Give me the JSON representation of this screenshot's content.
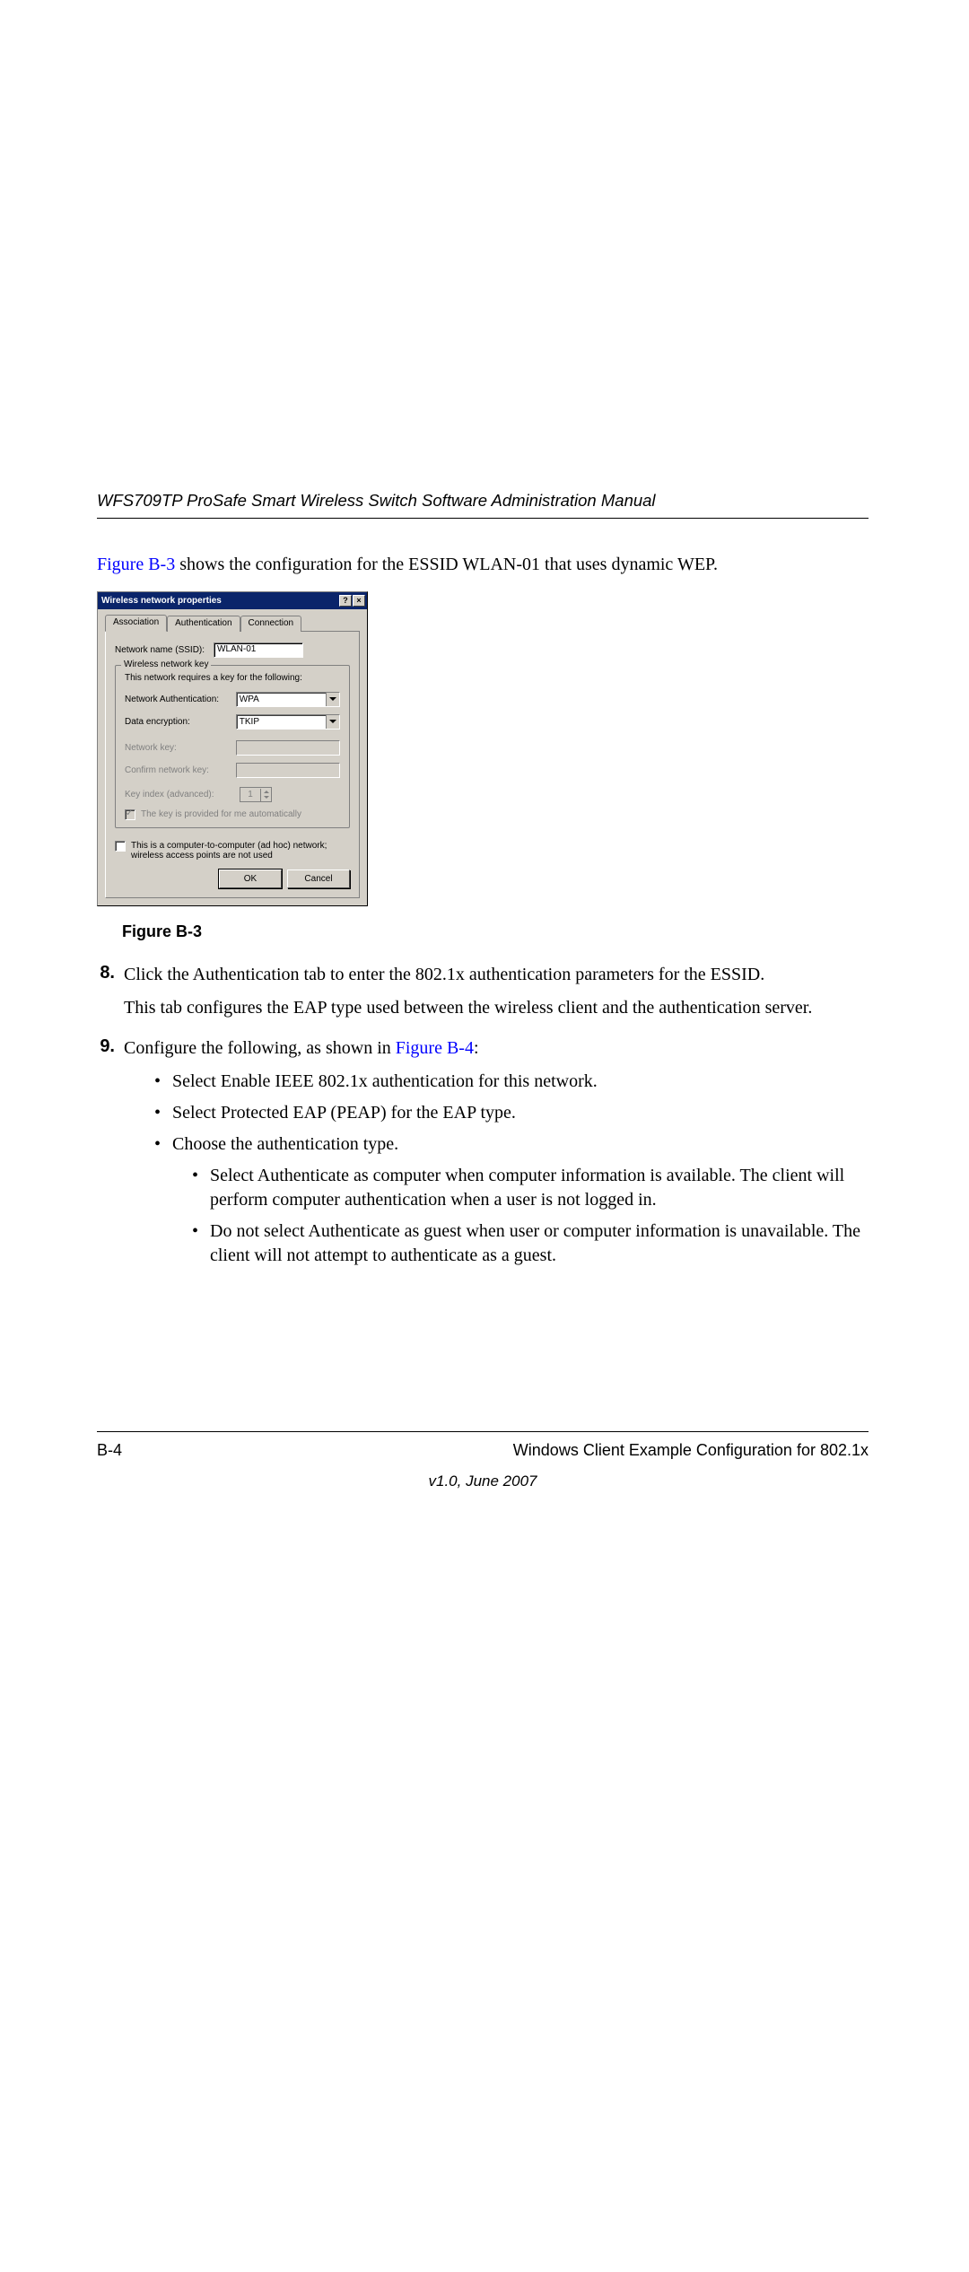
{
  "header": "WFS709TP ProSafe Smart Wireless Switch Software Administration Manual",
  "intro": {
    "figref": "Figure B-3",
    "rest": " shows the configuration for the ESSID WLAN-01 that uses dynamic WEP."
  },
  "dialog": {
    "title": "Wireless network properties",
    "help_btn": "?",
    "close_btn": "×",
    "tabs": {
      "t1": "Association",
      "t2": "Authentication",
      "t3": "Connection"
    },
    "ssid_label": "Network name (SSID):",
    "ssid_value": "WLAN-01",
    "fs_legend": "Wireless network key",
    "fs_note": "This network requires a key for the following:",
    "auth_label": "Network Authentication:",
    "auth_value": "WPA",
    "enc_label": "Data encryption:",
    "enc_value": "TKIP",
    "key_label": "Network key:",
    "confirm_label": "Confirm network key:",
    "keyidx_label": "Key index (advanced):",
    "keyidx_value": "1",
    "auto_label": "The key is provided for me automatically",
    "adhoc_label": "This is a computer-to-computer (ad hoc) network; wireless access points are not used",
    "ok": "OK",
    "cancel": "Cancel"
  },
  "figcap": "Figure B-3",
  "steps": {
    "s8_num": "8.",
    "s8_p1": "Click the Authentication tab to enter the 802.1x authentication parameters for the ESSID.",
    "s8_p2": "This tab configures the EAP type used between the wireless client and the authentication server.",
    "s9_num": "9.",
    "s9_lead": "Configure the following, as shown in ",
    "s9_ref": "Figure B-4",
    "s9_tail": ":",
    "b1": "Select Enable IEEE 802.1x authentication for this network.",
    "b2": "Select Protected EAP (PEAP) for the EAP type.",
    "b3": "Choose the authentication type.",
    "b3a": "Select Authenticate as computer when computer information is available. The client will perform computer authentication when a user is not logged in.",
    "b3b": "Do not select Authenticate as guest when user or computer information is unavailable. The client will not attempt to authenticate as a guest."
  },
  "footer": {
    "page": "B-4",
    "section": "Windows Client Example Configuration for 802.1x",
    "version": "v1.0, June 2007"
  }
}
